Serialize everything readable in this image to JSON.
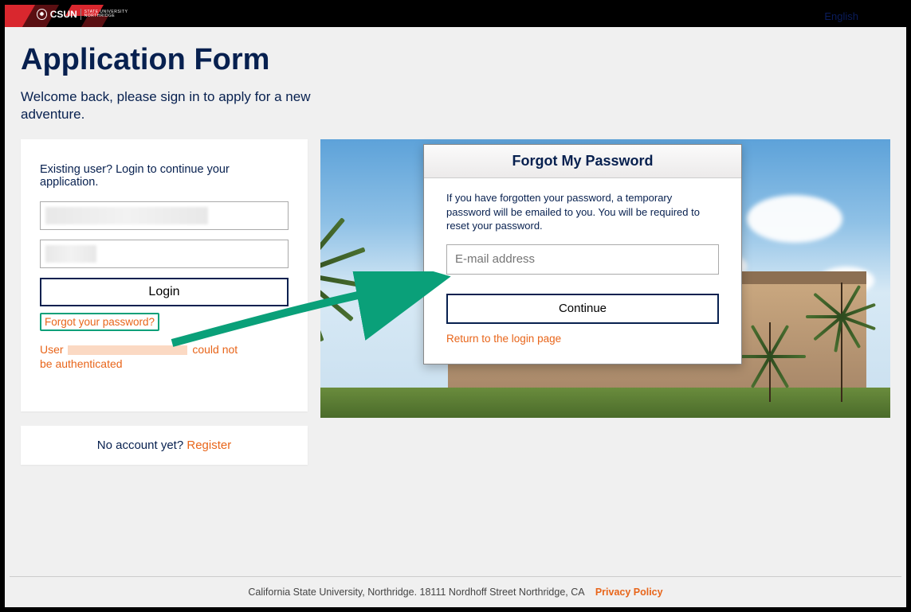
{
  "header": {
    "brand": "CSUN",
    "tagline": "STATE UNIVERSITY NORTHRIDGE",
    "language": "English"
  },
  "page": {
    "title": "Application Form",
    "welcome": "Welcome back, please sign in to apply for a new adventure."
  },
  "login": {
    "prompt": "Existing user? Login to continue your application.",
    "username_value": "",
    "password_value": "",
    "login_label": "Login",
    "forgot_label": "Forgot your password?",
    "error_prefix": "User",
    "error_suffix": "could not be authenticated"
  },
  "register": {
    "prompt": "No account yet?",
    "link": "Register"
  },
  "forgot_modal": {
    "title": "Forgot My Password",
    "body": "If you have forgotten your password, a temporary password will be emailed to you. You will be required to reset your password.",
    "email_placeholder": "E-mail address",
    "continue_label": "Continue",
    "return_label": "Return to the login page"
  },
  "footer": {
    "text": "California State University, Northridge. 18111 Nordhoff Street Northridge, CA",
    "privacy": "Privacy Policy"
  }
}
